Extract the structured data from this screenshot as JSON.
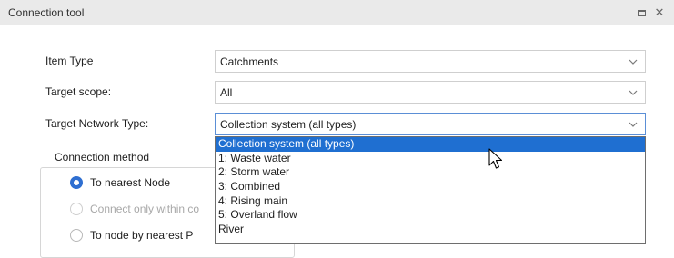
{
  "window": {
    "title": "Connection tool",
    "restore_icon": "restore-icon",
    "close_glyph": "✕"
  },
  "form": {
    "item_type": {
      "label": "Item Type",
      "value": "Catchments"
    },
    "target_scope": {
      "label": "Target scope:",
      "value": "All"
    },
    "target_network_type": {
      "label": "Target Network Type:",
      "value": "Collection system (all types)"
    }
  },
  "connection_method": {
    "legend": "Connection method",
    "options": [
      {
        "label": "To nearest Node",
        "checked": true,
        "disabled": false
      },
      {
        "label": "Connect only within co",
        "checked": false,
        "disabled": true
      },
      {
        "label": "To node by nearest P",
        "checked": false,
        "disabled": false
      }
    ]
  },
  "dropdown": {
    "options": [
      "Collection system (all types)",
      "1: Waste water",
      "2: Storm water",
      "3: Combined",
      "4: Rising main",
      "5: Overland flow",
      "River"
    ],
    "selected_index": 0
  },
  "colors": {
    "accent": "#1f6fd1",
    "radio_checked": "#2f6fd1",
    "titlebar_bg": "#eaeaea"
  }
}
